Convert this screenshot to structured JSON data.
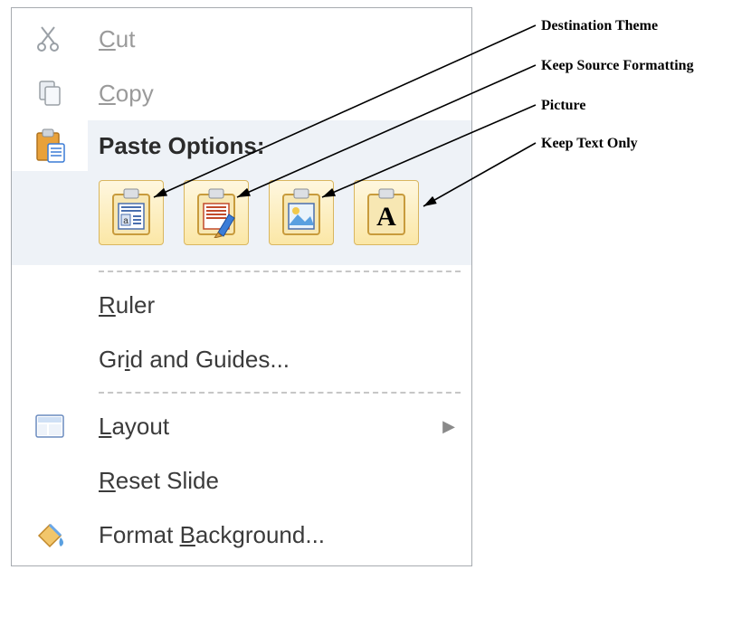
{
  "menu": {
    "cut": "Cut",
    "copy": "Copy",
    "paste_options_header": "Paste Options:",
    "paste_options": {
      "destination_theme": "Use Destination Theme",
      "keep_source": "Keep Source Formatting",
      "picture": "Picture",
      "keep_text_only": "Keep Text Only"
    },
    "ruler": "Ruler",
    "grid_guides": "Grid and Guides...",
    "layout": "Layout",
    "reset_slide": "Reset Slide",
    "format_background": "Format Background..."
  },
  "annotations": {
    "destination_theme": "Destination Theme",
    "keep_source": "Keep Source Formatting",
    "picture": "Picture",
    "keep_text_only": "Keep Text Only"
  }
}
